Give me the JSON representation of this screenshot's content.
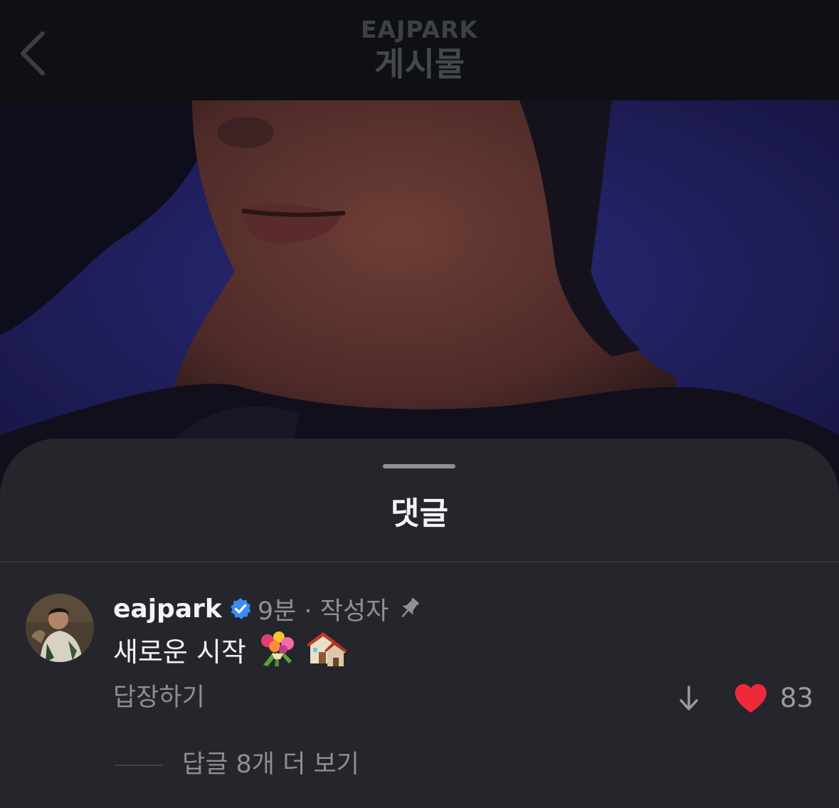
{
  "header": {
    "username": "EAJPARK",
    "title": "게시물",
    "back_icon": "chevron-left-icon"
  },
  "post_image": {
    "description_icon": "photo"
  },
  "comments_sheet": {
    "title": "댓글",
    "comment": {
      "username": "eajpark",
      "verified_icon": "verified-badge-icon",
      "meta": "9분 · 작성자",
      "pinned_icon": "pin-icon",
      "text": "새로운 시작",
      "emojis": [
        "bouquet-emoji",
        "houses-emoji"
      ],
      "reply_label": "답장하기",
      "like_count": "83",
      "liked": true,
      "view_replies_label": "답글 8개 더 보기"
    }
  },
  "colors": {
    "sheet_bg": "#24262b",
    "nav_bg": "#0f1013",
    "verified": "#3b8cf6",
    "heart": "#ee2a3a"
  }
}
